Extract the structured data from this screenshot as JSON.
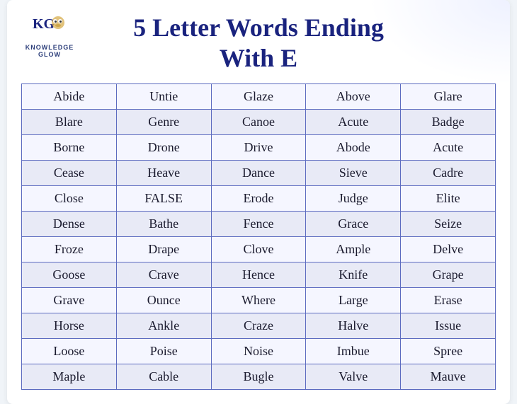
{
  "title_line1": "5 Letter Words Ending",
  "title_line2": "With E",
  "logo": {
    "brand": "KG",
    "tagline": "KNOWLEDGE GLOW"
  },
  "table": {
    "rows": [
      [
        "Abide",
        "Untie",
        "Glaze",
        "Above",
        "Glare"
      ],
      [
        "Blare",
        "Genre",
        "Canoe",
        "Acute",
        "Badge"
      ],
      [
        "Borne",
        "Drone",
        "Drive",
        "Abode",
        "Acute"
      ],
      [
        "Cease",
        "Heave",
        "Dance",
        "Sieve",
        "Cadre"
      ],
      [
        "Close",
        "FALSE",
        "Erode",
        "Judge",
        "Elite"
      ],
      [
        "Dense",
        "Bathe",
        "Fence",
        "Grace",
        "Seize"
      ],
      [
        "Froze",
        "Drape",
        "Clove",
        "Ample",
        "Delve"
      ],
      [
        "Goose",
        "Crave",
        "Hence",
        "Knife",
        "Grape"
      ],
      [
        "Grave",
        "Ounce",
        "Where",
        "Large",
        "Erase"
      ],
      [
        "Horse",
        "Ankle",
        "Craze",
        "Halve",
        "Issue"
      ],
      [
        "Loose",
        "Poise",
        "Noise",
        "Imbue",
        "Spree"
      ],
      [
        "Maple",
        "Cable",
        "Bugle",
        "Valve",
        "Mauve"
      ]
    ]
  }
}
